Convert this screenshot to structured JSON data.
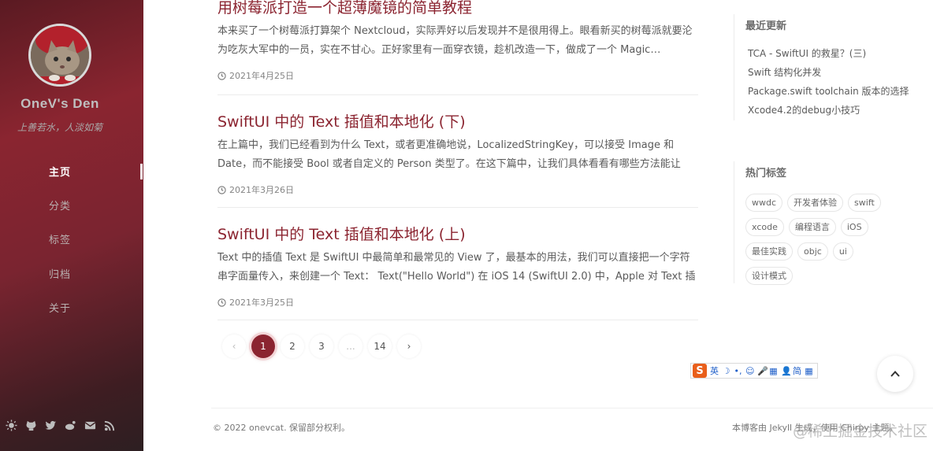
{
  "sidebar": {
    "title": "OneV's Den",
    "subtitle": "上善若水，人淡如菊",
    "nav": [
      {
        "label": "主页"
      },
      {
        "label": "分类"
      },
      {
        "label": "标签"
      },
      {
        "label": "归档"
      },
      {
        "label": "关于"
      }
    ],
    "active_nav": "主页",
    "social_icons": [
      "theme-toggle-icon",
      "github-icon",
      "twitter-icon",
      "weibo-icon",
      "email-icon",
      "rss-icon"
    ]
  },
  "posts": [
    {
      "title": "用树莓派打造一个超薄魔镜的简单教程",
      "excerpt": "本来买了一个树莓派打算架个 Nextcloud，实际弄好以后发现并不是很用得上。眼看新买的树莓派就要沦为吃灰大军中的一员，实在不甘心。正好家里有一面穿衣镜，趁机改造一下，做成了一个 Magic…",
      "date": "2021年4月25日"
    },
    {
      "title": "SwiftUI 中的 Text 插值和本地化 (下)",
      "excerpt": "在上篇中，我们已经看到为什么 Text，或者更准确地说，LocalizedStringKey，可以接受 Image 和 Date，而不能接受 Bool 或者自定义的 Person 类型了。在这下篇中，让我们具体看看有哪些方法能让 Text 支…",
      "date": "2021年3月26日"
    },
    {
      "title": "SwiftUI 中的 Text 插值和本地化 (上)",
      "excerpt": "Text 中的插值 Text 是 SwiftUI 中最简单和最常见的 View 了，最基本的用法，我们可以直接把一个字符串字面量传入，来创建一个 Text： Text(\"Hello World\") 在 iOS 14 (SwiftUI 2.0) 中，Apple 对 Text 插值进行了…",
      "date": "2021年3月25日"
    }
  ],
  "pagination": {
    "prev": "‹",
    "pages": [
      "1",
      "2",
      "3",
      "...",
      "14"
    ],
    "current": "1",
    "next": "›"
  },
  "recent": {
    "title": "最近更新",
    "items": [
      "TCA - SwiftUI 的救星？(三)",
      "Swift 结构化并发",
      "Package.swift toolchain 版本的选择",
      "Xcode4.2的debug小技巧"
    ]
  },
  "tags": {
    "title": "热门标签",
    "rows": [
      [
        "wwdc",
        "开发者体验",
        "swift"
      ],
      [
        "xcode",
        "编程语言",
        "iOS"
      ],
      [
        "最佳实践",
        "objc",
        "ui"
      ],
      [
        "设计模式"
      ]
    ]
  },
  "ime": {
    "logo": "S",
    "items": [
      "英",
      "☽",
      "•,",
      "☺",
      "🎤",
      "▦",
      "👤",
      "简",
      "▦"
    ]
  },
  "footer": {
    "copyright": "© 2022 onevcat. 保留部分权利。",
    "powered": "本博客由 Jekyll 生成，使用 Chirpy 主题。",
    "watermark": "@稀土掘金技术社区"
  },
  "colors": {
    "accent": "#8b2430",
    "sidebar_top": "#8a2530",
    "sidebar_bottom": "#2d1f22"
  }
}
